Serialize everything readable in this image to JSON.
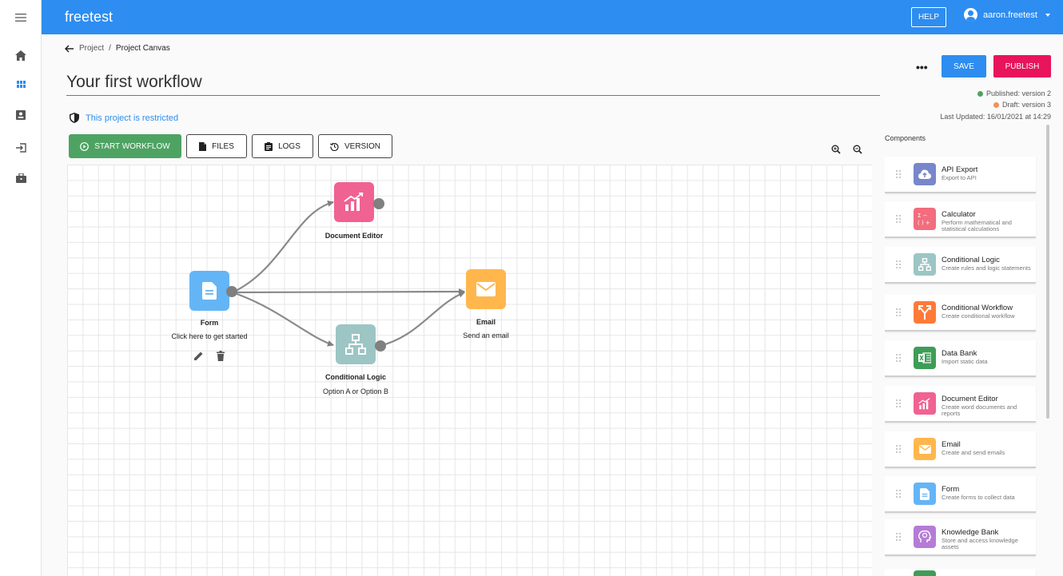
{
  "app": {
    "brand": "freetest"
  },
  "header": {
    "help_label": "HELP",
    "username": "aaron.freetest"
  },
  "sidebar": {
    "items": [
      {
        "name": "home-icon"
      },
      {
        "name": "dashboard-icon"
      },
      {
        "name": "contact-card-icon"
      },
      {
        "name": "sign-in-icon"
      },
      {
        "name": "briefcase-icon"
      }
    ]
  },
  "breadcrumb": {
    "parent": "Project",
    "separator": "/",
    "current": "Project Canvas"
  },
  "page": {
    "title": "Your first workflow",
    "restricted_text": "This project is restricted"
  },
  "toolbar": {
    "start": "START WORKFLOW",
    "files": "FILES",
    "logs": "LOGS",
    "version": "VERSION"
  },
  "actions": {
    "more": "•••",
    "save": "SAVE",
    "publish": "PUBLISH"
  },
  "status": {
    "published": "Published: version 2",
    "draft": "Draft: version 3",
    "last_updated": "Last Updated: 16/01/2021 at 14:29",
    "published_color": "#4ea363",
    "draft_color": "#f0935a"
  },
  "canvas": {
    "nodes": {
      "form": {
        "title": "Form",
        "subtitle": "Click here to get started",
        "color": "#64b5f6"
      },
      "document_editor": {
        "title": "Document Editor",
        "color": "#f06292"
      },
      "email": {
        "title": "Email",
        "subtitle": "Send an email",
        "color": "#ffb74d"
      },
      "conditional_logic": {
        "title": "Conditional Logic",
        "subtitle": "Option A or Option B",
        "color": "#9cc5c4"
      }
    }
  },
  "components": {
    "title": "Components",
    "items": [
      {
        "name": "API Export",
        "desc": "Export to API",
        "color": "#7986cb"
      },
      {
        "name": "Calculator",
        "desc": "Perform mathematical and statistical calculations",
        "color": "#f26d7d"
      },
      {
        "name": "Conditional Logic",
        "desc": "Create rules and logic statements",
        "color": "#9cc5c4"
      },
      {
        "name": "Conditional Workflow",
        "desc": "Create conditional workflow",
        "color": "#ff7a38"
      },
      {
        "name": "Data Bank",
        "desc": "Import static data",
        "color": "#3e9d57"
      },
      {
        "name": "Document Editor",
        "desc": "Create word documents and reports",
        "color": "#f06292"
      },
      {
        "name": "Email",
        "desc": "Create and send emails",
        "color": "#ffb74d"
      },
      {
        "name": "Form",
        "desc": "Create forms to collect data",
        "color": "#64b5f6"
      },
      {
        "name": "Knowledge Bank",
        "desc": "Store and access knowledge assets",
        "color": "#b47cd6"
      }
    ]
  }
}
